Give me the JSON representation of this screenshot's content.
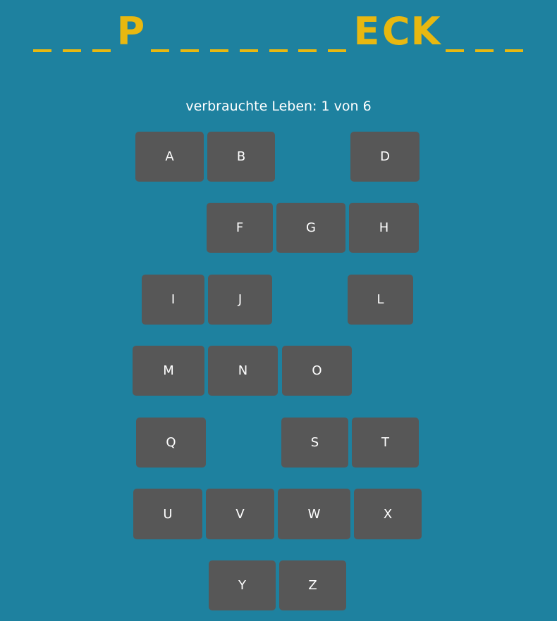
{
  "word": [
    "",
    "",
    "",
    "P",
    "",
    "",
    "",
    "",
    "",
    "",
    "",
    "E",
    "C",
    "K",
    "",
    "",
    ""
  ],
  "lives_text": "verbrauchte Leben: 1 von 6",
  "keys": {
    "A": "A",
    "B": "B",
    "D": "D",
    "F": "F",
    "G": "G",
    "H": "H",
    "I": "I",
    "J": "J",
    "L": "L",
    "M": "M",
    "N": "N",
    "O": "O",
    "Q": "Q",
    "S": "S",
    "T": "T",
    "U": "U",
    "V": "V",
    "W": "W",
    "X": "X",
    "Y": "Y",
    "Z": "Z"
  },
  "colors": {
    "background": "#1e819f",
    "accent": "#e8b810",
    "key": "#575757"
  }
}
